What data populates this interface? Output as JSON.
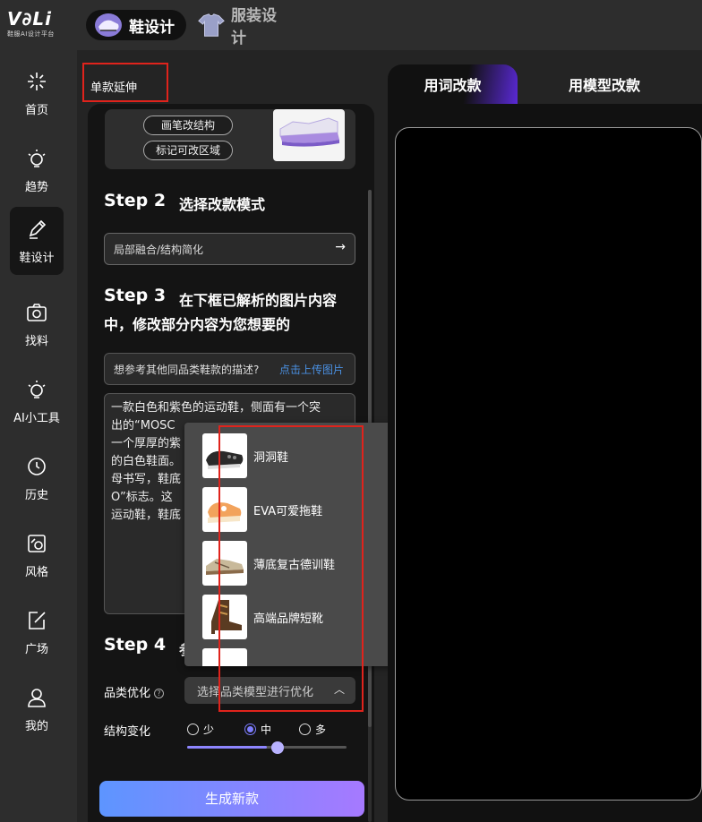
{
  "app": {
    "logo_text": "V∂Li",
    "logo_sub": "鞋服AI设计平台"
  },
  "top_tabs": [
    {
      "label": "鞋设计",
      "active": true
    },
    {
      "label": "服装设计",
      "active": false
    }
  ],
  "nav": [
    {
      "label": "首页",
      "icon": "sparkle-icon"
    },
    {
      "label": "趋势",
      "icon": "bulb-icon"
    },
    {
      "label": "鞋设计",
      "icon": "pen-icon",
      "active": true
    },
    {
      "label": "找料",
      "icon": "camera-icon"
    },
    {
      "label": "AI小工具",
      "icon": "bulb-icon"
    },
    {
      "label": "历史",
      "icon": "history-icon"
    },
    {
      "label": "风格",
      "icon": "style-icon"
    },
    {
      "label": "广场",
      "icon": "edit-square-icon"
    },
    {
      "label": "我的",
      "icon": "user-icon"
    }
  ],
  "panel": {
    "title": "单款延伸",
    "pills": [
      "画笔改结构",
      "标记可改区域"
    ],
    "step2": {
      "label": "Step 2",
      "desc": "选择改款模式"
    },
    "mode_value": "局部融合/结构简化",
    "step3": {
      "label": "Step 3",
      "desc_line1": "在下框已解析的图片内容",
      "desc_line2": "中，修改部分内容为您想要的"
    },
    "ref_prompt": "想参考其他同品类鞋款的描述?",
    "ref_link": "点击上传图片",
    "desc_lines": [
      "一款白色和紫色的运动鞋，侧面有一个突",
      "出的“MOSC",
      "一个厚厚的紫",
      "的白色鞋面。",
      "母书写，鞋底",
      "O”标志。这",
      "运动鞋，鞋底"
    ],
    "step4": {
      "label": "Step 4"
    },
    "category_label": "品类优化",
    "category_placeholder": "选择品类模型进行优化",
    "structure_label": "结构变化",
    "radio_options": [
      "少",
      "中",
      "多"
    ],
    "radio_selected": "中",
    "slider_level": 0.5,
    "generate_label": "生成新款"
  },
  "dropdown": {
    "options": [
      "洞洞鞋",
      "EVA可爱拖鞋",
      "薄底复古德训鞋",
      "高端品牌短靴"
    ]
  },
  "right": {
    "tabs": [
      "用词改款",
      "用模型改款"
    ]
  },
  "colors": {
    "accent_purple": "#6b2cf5",
    "highlight_red": "#e0231c",
    "link_blue": "#4a90e2",
    "button_start": "#5d95ff",
    "button_end": "#a679ff"
  }
}
